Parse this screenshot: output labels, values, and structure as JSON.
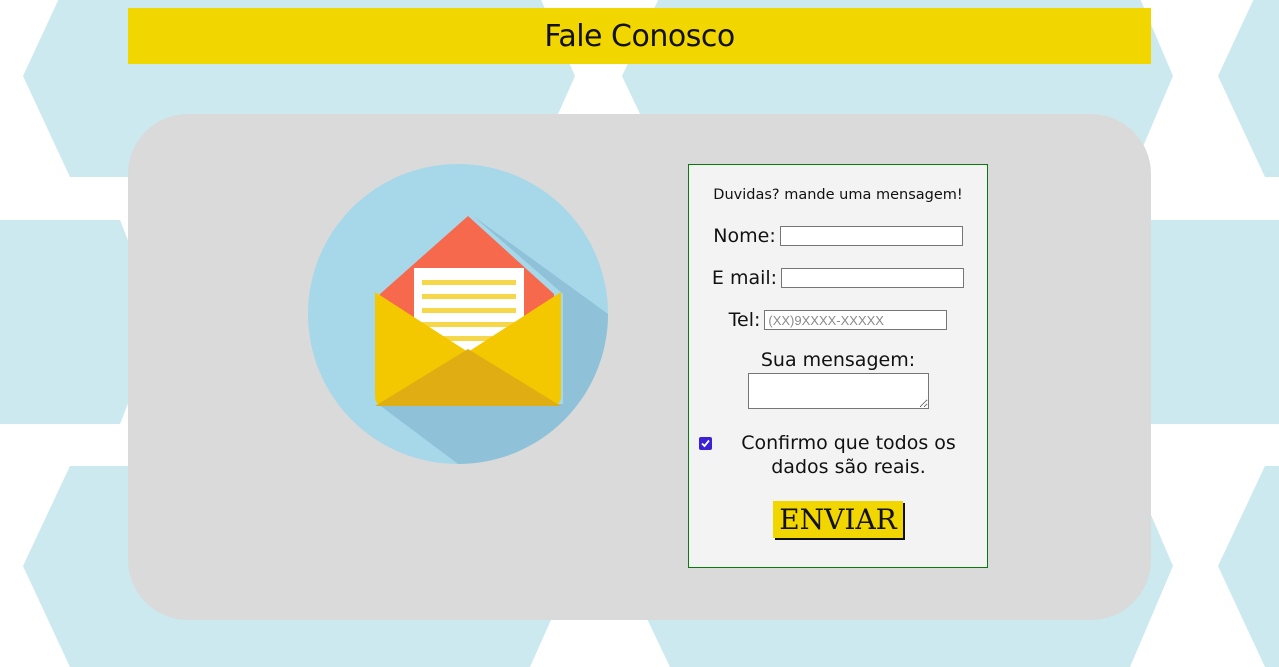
{
  "header": {
    "title": "Fale Conosco"
  },
  "form": {
    "intro": "Duvidas? mande uma mensagem!",
    "name_label": "Nome:",
    "name_value": "",
    "email_label": "E mail:",
    "email_value": "",
    "tel_label": "Tel:",
    "tel_placeholder": "(XX)9XXXX-XXXXX",
    "message_label": "Sua mensagem:",
    "confirm_checked": true,
    "confirm_text": "Confirmo que todos os dados são reais.",
    "submit_label": "ENVIAR"
  },
  "colors": {
    "header_bg": "#f2d600",
    "panel_bg": "#dadada",
    "pattern": "#cbe9ef",
    "form_border": "#0a7a0a",
    "checkbox": "#3a21d6"
  },
  "illustration": {
    "icon": "open-envelope-icon"
  }
}
